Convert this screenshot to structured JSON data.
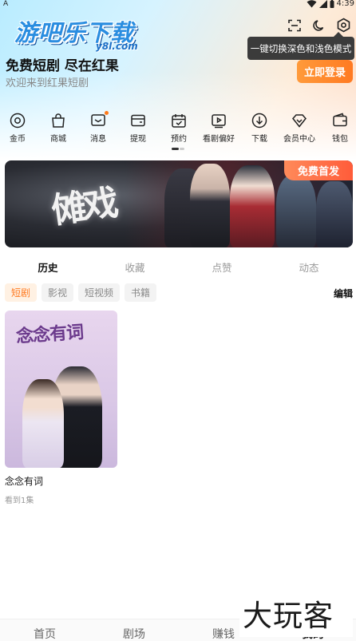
{
  "status_bar": {
    "left_glyph": "A",
    "time": "4:39"
  },
  "logo": {
    "main": "游吧乐下载",
    "sub": "y8l.com"
  },
  "top_icons": [
    "scan-icon",
    "moon-icon",
    "settings-icon"
  ],
  "tooltip": {
    "text": "一键切换深色和浅色模式"
  },
  "welcome": {
    "title": "免费短剧 尽在红果",
    "subtitle": "欢迎来到红果短剧",
    "login_label": "立即登录"
  },
  "quick_menu": [
    {
      "label": "金币",
      "icon": "coin-icon"
    },
    {
      "label": "商城",
      "icon": "shopping-bag-icon"
    },
    {
      "label": "消息",
      "icon": "message-icon"
    },
    {
      "label": "提现",
      "icon": "withdraw-icon"
    },
    {
      "label": "预约",
      "icon": "calendar-icon"
    },
    {
      "label": "看剧偏好",
      "icon": "video-icon"
    },
    {
      "label": "下载",
      "icon": "download-icon"
    },
    {
      "label": "会员中心",
      "icon": "diamond-icon"
    },
    {
      "label": "钱包",
      "icon": "wallet-icon"
    }
  ],
  "banner": {
    "title": "傩戏",
    "badge": "免费首发"
  },
  "tabs": [
    "历史",
    "收藏",
    "点赞",
    "动态"
  ],
  "chips": [
    "短剧",
    "影视",
    "短视频",
    "书籍"
  ],
  "edit_label": "编辑",
  "history": [
    {
      "poster_title": "念念有词",
      "title": "念念有词",
      "progress": "看到1集"
    }
  ],
  "bottom_nav": [
    "首页",
    "剧场",
    "赚钱",
    "我的"
  ],
  "watermark": "大玩客",
  "colors": {
    "accent": "#ff7a22",
    "tooltip_bg": "#3b3b3b",
    "logo_blue": "#2a8de0"
  }
}
